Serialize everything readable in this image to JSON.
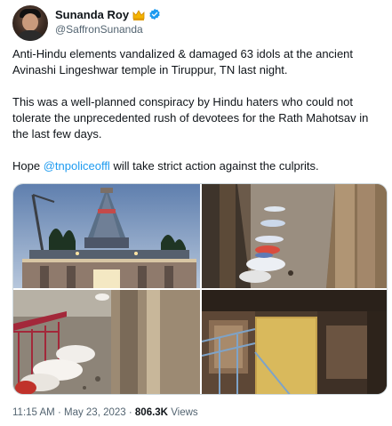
{
  "user": {
    "display_name": "Sunanda Roy",
    "handle": "@SaffronSunanda",
    "avatar_icon": "profile-photo",
    "badge_icons": [
      "crown-icon",
      "verified-icon"
    ],
    "verified_color": "#1d9bf0"
  },
  "tweet": {
    "paragraph1": "Anti-Hindu elements vandalized & damaged 63 idols at the ancient Avinashi Lingeshwar temple in Tiruppur, TN last night.",
    "paragraph2": "This was a well-planned conspiracy by Hindu haters who could not tolerate the unprecedented rush of devotees for the Rath Mahotsav in the last few days.",
    "paragraph3_prefix": "Hope ",
    "mention": "@tnpoliceoffl",
    "paragraph3_suffix": " will take strict action against the culprits.",
    "mention_color": "#1d9bf0"
  },
  "media": [
    {
      "label": "temple-gopuram-photo"
    },
    {
      "label": "damaged-idols-corridor-photo"
    },
    {
      "label": "broken-idols-wrapped-photo"
    },
    {
      "label": "temple-chariot-interior-photo"
    }
  ],
  "meta": {
    "time": "11:15 AM",
    "separator1": " · ",
    "date": "May 23, 2023",
    "separator2": " · ",
    "views_count": "806.3K",
    "views_label": " Views"
  }
}
